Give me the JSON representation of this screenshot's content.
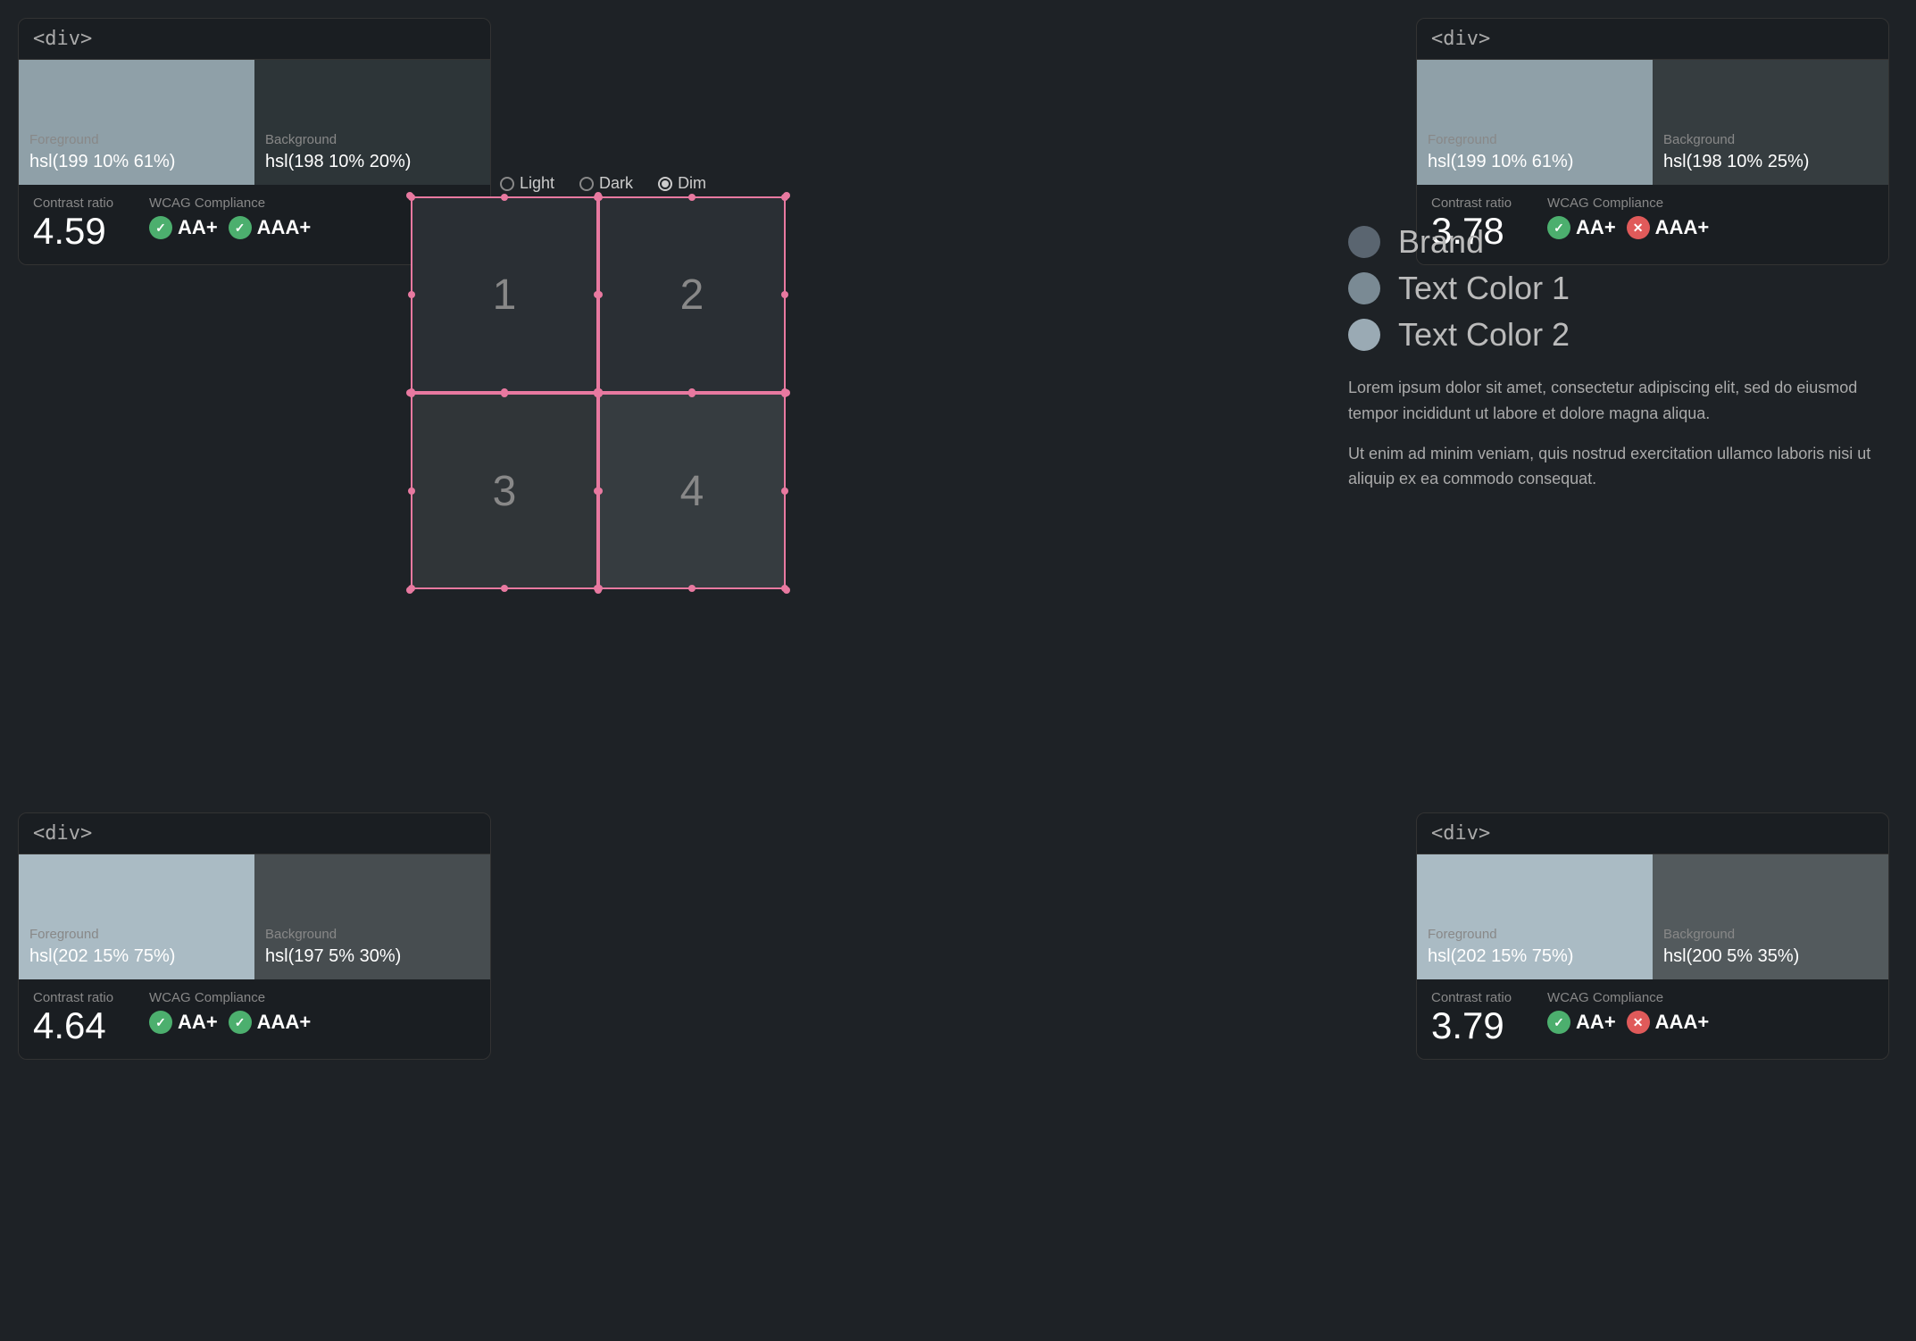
{
  "panels": {
    "tl": {
      "tag": "<div>",
      "fg_label": "Foreground",
      "fg_value": "hsl(199 10% 61%)",
      "fg_color": "#8fa0a8",
      "bg_label": "Background",
      "bg_value": "hsl(198 10% 20%)",
      "bg_color": "#2d3538",
      "contrast_label": "Contrast ratio",
      "contrast_value": "4.59",
      "wcag_label": "WCAG Compliance",
      "aa_label": "AA+",
      "aaa_label": "AAA+",
      "aa_pass": true,
      "aaa_pass": true
    },
    "tr": {
      "tag": "<div>",
      "fg_label": "Foreground",
      "fg_value": "hsl(199 10% 61%)",
      "fg_color": "#8fa0a8",
      "bg_label": "Background",
      "bg_value": "hsl(198 10% 25%)",
      "bg_color": "#363d40",
      "contrast_label": "Contrast ratio",
      "contrast_value": "3.78",
      "wcag_label": "WCAG Compliance",
      "aa_label": "AA+",
      "aaa_label": "AAA+",
      "aa_pass": true,
      "aaa_pass": false
    },
    "bl": {
      "tag": "<div>",
      "fg_label": "Foreground",
      "fg_value": "hsl(202 15% 75%)",
      "fg_color": "#aabbc4",
      "bg_label": "Background",
      "bg_value": "hsl(197 5% 30%)",
      "bg_color": "#474d50",
      "contrast_label": "Contrast ratio",
      "contrast_value": "4.64",
      "wcag_label": "WCAG Compliance",
      "aa_label": "AA+",
      "aaa_label": "AAA+",
      "aa_pass": true,
      "aaa_pass": true
    },
    "br": {
      "tag": "<div>",
      "fg_label": "Foreground",
      "fg_value": "hsl(202 15% 75%)",
      "fg_color": "#aabbc4",
      "bg_label": "Background",
      "bg_value": "hsl(200 5% 35%)",
      "bg_color": "#535a5d",
      "contrast_label": "Contrast ratio",
      "contrast_value": "3.79",
      "wcag_label": "WCAG Compliance",
      "aa_label": "AA+",
      "aaa_label": "AAA+",
      "aa_pass": true,
      "aaa_pass": false
    }
  },
  "theme_options": [
    {
      "label": "Light",
      "selected": false
    },
    {
      "label": "Dark",
      "selected": false
    },
    {
      "label": "Dim",
      "selected": true
    }
  ],
  "grid": {
    "cells": [
      "1",
      "2",
      "3",
      "4"
    ]
  },
  "legend": {
    "items": [
      {
        "label": "Brand",
        "color": "#5a6570"
      },
      {
        "label": "Text Color 1",
        "color": "#7a8a94"
      },
      {
        "label": "Text Color 2",
        "color": "#9aaab4"
      }
    ]
  },
  "lorem": {
    "p1": "Lorem ipsum dolor sit amet, consectetur adipiscing elit, sed do eiusmod tempor incididunt ut labore et dolore magna aliqua.",
    "p2": "Ut enim ad minim veniam, quis nostrud exercitation ullamco laboris nisi ut aliquip ex ea commodo consequat."
  }
}
